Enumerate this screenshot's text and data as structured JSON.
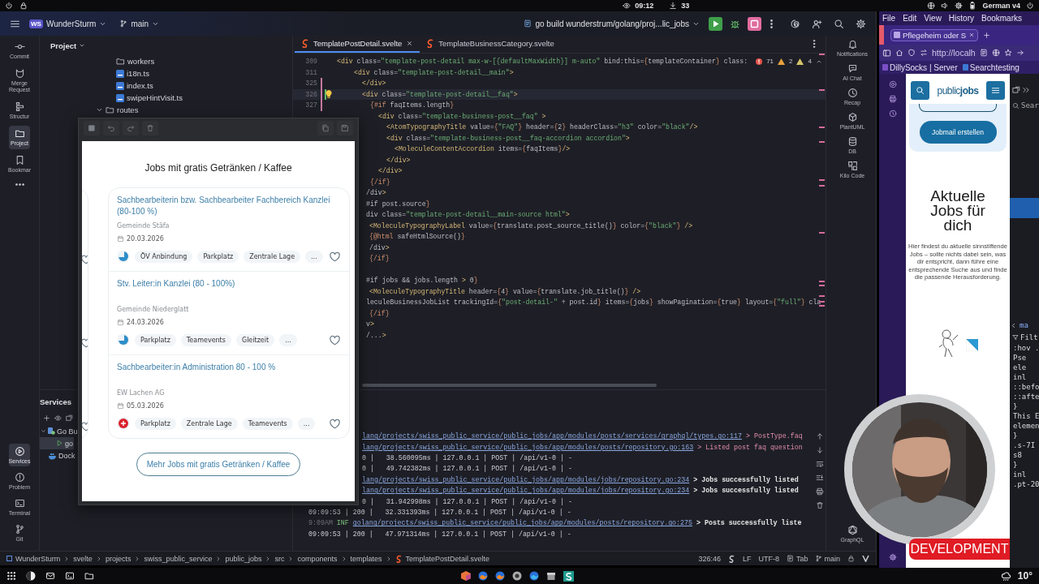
{
  "system_bar": {
    "clock": "09:12",
    "downloads": "33",
    "keyboard_layout": "German v4"
  },
  "ide": {
    "project": {
      "badge": "WS",
      "name": "WunderSturm"
    },
    "branch": "main",
    "run_configuration": "go build wunderstrum/golang/proj...lic_jobs",
    "left_tools": [
      {
        "label": "Commit",
        "selected": false
      },
      {
        "label": "Merge Request",
        "selected": false
      },
      {
        "label": "Structur",
        "selected": false
      },
      {
        "label": "Project",
        "selected": true
      },
      {
        "label": "Bookmar",
        "selected": false
      }
    ],
    "left_tools_bottom": [
      {
        "label": "Services",
        "selected": true
      },
      {
        "label": "Problem",
        "selected": false
      },
      {
        "label": "Terminal",
        "selected": false
      },
      {
        "label": "Git",
        "selected": false
      }
    ],
    "project_panel": {
      "title": "Project",
      "tree": [
        {
          "label": "workers",
          "kind": "folder"
        },
        {
          "label": "i18n.ts",
          "kind": "ts"
        },
        {
          "label": "index.ts",
          "kind": "ts"
        },
        {
          "label": "swipeHintVisit.ts",
          "kind": "ts"
        },
        {
          "label": "routes",
          "kind": "folder",
          "expanded": true
        }
      ]
    },
    "services_panel": {
      "title": "Services",
      "tree": [
        {
          "label": "Go Bu",
          "kind": "go",
          "expanded": true,
          "selected": false,
          "children": [
            {
              "label": "go",
              "kind": "run",
              "selected": true
            }
          ]
        },
        {
          "label": "Dock",
          "kind": "docker",
          "selected": false
        }
      ]
    },
    "editor": {
      "tabs": [
        {
          "label": "TemplatePostDetail.svelte",
          "selected": true
        },
        {
          "label": "TemplateBusinessCategory.svelte",
          "selected": false
        }
      ],
      "inspections": {
        "errors": "71",
        "warnings": "2",
        "weak_warnings": "4"
      },
      "code_lines": [
        {
          "number": "309",
          "text": "<div class=\"template-post-detail max-w-[{defaultMaxWidth}] m-auto\" bind:this={templateContainer} class:",
          "current": false
        },
        {
          "number": "311",
          "text": "<div class=\"template-post-detail__main\">",
          "current": false
        },
        {
          "number": "325",
          "text": "</div>",
          "current": false
        },
        {
          "number": "326",
          "text": "<div class=\"template-post-detail__faq\">",
          "current": true
        },
        {
          "number": "327",
          "text": "{#if faqItems.length}",
          "current": false
        },
        {
          "text": "<div class=\"template-business-post__faq\" >",
          "current": false
        },
        {
          "text": "<AtomTypographyTitle value={\"FAQ\"} header={2} headerClass=\"h3\" color=\"black\"/>",
          "current": false
        },
        {
          "text": "<div class=\"template-business-post__faq-accordion accordion\">",
          "current": false
        },
        {
          "text": "<MoleculeContentAccordion items={faqItems}/>",
          "current": false
        },
        {
          "text": "</div>",
          "current": false
        },
        {
          "text": "</div>",
          "current": false
        },
        {
          "text": "{/if}",
          "current": false
        },
        {
          "text": "/div>",
          "current": false
        },
        {
          "text": "#if post.source}",
          "current": false
        },
        {
          "text": "div class=\"template-post-detail__main-source html\">",
          "current": false
        },
        {
          "text": "<MoleculeTypographyLabel value={translate.post_source_title()} color={\"black\"} />",
          "current": false
        },
        {
          "text": "{@html safeHtmlSource()}",
          "current": false
        },
        {
          "text": "/div>",
          "current": false
        },
        {
          "text": "{/if}",
          "current": false
        },
        {
          "text": "#if jobs && jobs.length > 0}",
          "current": false
        },
        {
          "text": "<MoleculeTypographyTitle header={4} value={translate.job_title()} />",
          "current": false
        },
        {
          "text": "leculeBusinessJobList trackingId={\"post-detail-\" + post.id} items={jobs} showPagination={true} layout={\"full\"} cla",
          "current": false
        },
        {
          "text": "{/if}",
          "current": false
        },
        {
          "text": "v>",
          "current": false
        },
        {
          "text": "/...>",
          "current": false
        }
      ]
    },
    "log_lines": [
      [
        {
          "kind": "link",
          "text": "lang/projects/swiss_public_service/public_jobs/app/modules/posts/services/graphql/types.go:117"
        },
        {
          "kind": "message",
          "text": " > PostType.faq"
        }
      ],
      [
        {
          "kind": "link",
          "text": "lang/projects/swiss_public_service/public_jobs/app/modules/posts/repository.go:163"
        },
        {
          "kind": "message",
          "text": " > Listed post faq question"
        }
      ],
      [
        {
          "kind": "plain",
          "text": "0 |   38.560095ms | 127.0.0.1 | POST | /api/v1-0 | -"
        }
      ],
      [
        {
          "kind": "plain",
          "text": "0 |   49.742382ms | 127.0.0.1 | POST | /api/v1-0 | -"
        }
      ],
      [
        {
          "kind": "link",
          "text": "lang/projects/swiss_public_service/public_jobs/app/modules/jobs/repository.go:234"
        },
        {
          "kind": "bold",
          "text": " > Jobs successfully listed"
        }
      ],
      [
        {
          "kind": "link",
          "text": "lang/projects/swiss_public_service/public_jobs/app/modules/jobs/repository.go:234"
        },
        {
          "kind": "bold",
          "text": " > Jobs successfully listed"
        }
      ],
      [
        {
          "kind": "plain",
          "text": "0 |   31.942998ms | 127.0.0.1 | POST | /api/v1-0 | -"
        }
      ],
      [
        {
          "kind": "plain",
          "text": "09:09:53 | 200 |   32.331393ms | 127.0.0.1 | POST | /api/v1-0 | -"
        }
      ],
      [
        {
          "kind": "dim",
          "text": "9:09AM "
        },
        {
          "kind": "level",
          "text": "INF "
        },
        {
          "kind": "link",
          "text": "golang/projects/swiss_public_service/public_jobs/app/modules/posts/repository.go:275"
        },
        {
          "kind": "bold",
          "text": " > Posts successfully liste"
        }
      ],
      [
        {
          "kind": "plain",
          "text": "09:09:53 | 200 |   47.971314ms | 127.0.0.1 | POST | /api/v1-0 | -"
        }
      ]
    ],
    "right_tools": [
      {
        "label": "Notifications"
      },
      {
        "label": "AI Chat"
      },
      {
        "label": "Recap"
      },
      {
        "label": "PlantUML"
      },
      {
        "label": "DB"
      },
      {
        "label": "Kilo Code"
      }
    ],
    "right_tools_bottom": [
      {
        "label": "GraphQL"
      }
    ],
    "status_bar": {
      "breadcrumbs": [
        "WunderSturm",
        "svelte",
        "projects",
        "swiss_public_service",
        "public_jobs",
        "src",
        "components",
        "templates",
        "TemplatePostDetail.svelte"
      ],
      "position": "326:46",
      "line_separator": "LF",
      "encoding": "UTF-8",
      "indent": "Tab",
      "branch": "main"
    }
  },
  "preview_window": {
    "heading": "Jobs mit gratis Getränken / Kaffee",
    "jobs": [
      {
        "title": "Sachbearbeiterin bzw. Sachbearbeiter Fachbereich Kanzlei (80-100 %)",
        "company": "Gemeinde Stäfa",
        "date": "20.03.2026",
        "color": "#2d8ec9",
        "tags": [
          "ÖV Anbindung",
          "Parkplatz",
          "Zentrale Lage",
          "..."
        ]
      },
      {
        "title": "Stv. Leiter:in Kanzlei (80 - 100%)",
        "company": "Gemeinde Niederglatt",
        "date": "24.03.2026",
        "color": "#2d8ec9",
        "tags": [
          "Parkplatz",
          "Teamevents",
          "Gleitzeit",
          "..."
        ]
      },
      {
        "title": "Sachbearbeiter:in Administration 80 - 100 %",
        "company": "EW Lachen AG",
        "date": "05.03.2026",
        "color": "#d9232e",
        "tags": [
          "Parkplatz",
          "Zentrale Lage",
          "Teamevents",
          "..."
        ]
      }
    ],
    "more_button": "Mehr Jobs mit gratis Getränken / Kaffee"
  },
  "browser": {
    "menu": [
      "File",
      "Edit",
      "View",
      "History",
      "Bookmarks"
    ],
    "tab": "Pflegeheim oder S",
    "url": "http://localh",
    "bookmarks": [
      "DillySocks | Server",
      "Searchtesting"
    ],
    "page": {
      "logo": "public**jobs**",
      "jobmail_button": "Jobmail erstellen",
      "heading": "Aktuelle Jobs für dich",
      "intro": "Hier findest du aktuelle sinnstiftende Jobs – sollte nichts dabei sein, was dir entspricht, dann führe eine entsprechende Suche aus und finde die passende Herausforderung.",
      "environment_banner": "DEVELOPMENT"
    },
    "devtools": {
      "search": "Sear",
      "tab": "ma",
      "filter": "Filt",
      "lines": [
        ":hov .",
        "Pse",
        "ele",
        "inl",
        "::befo",
        "::afte",
        "}",
        "This E",
        "elemen",
        "}",
        ".s-7I",
        "s8",
        "}",
        "inl",
        ".pt-20"
      ]
    }
  },
  "taskbar": {
    "temperature": "10°"
  }
}
